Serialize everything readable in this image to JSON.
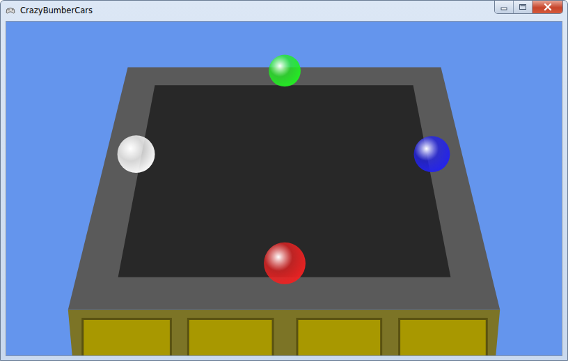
{
  "window": {
    "title": "CrazyBumberCars"
  },
  "balls": [
    {
      "color": "#22ee22"
    },
    {
      "color": "#ffffff"
    },
    {
      "color": "#2222ee"
    },
    {
      "color": "#ee2222"
    }
  ]
}
